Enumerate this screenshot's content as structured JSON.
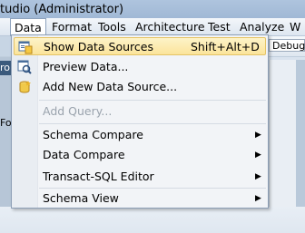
{
  "window": {
    "title": "tudio (Administrator)"
  },
  "menubar": {
    "items": [
      "Data",
      "Format",
      "Tools",
      "Architecture",
      "Test",
      "Analyze",
      "W"
    ]
  },
  "toolbar": {
    "config_value": "Debug"
  },
  "side": {
    "tab1": "ro",
    "tab2": "Fo"
  },
  "menu": {
    "items": [
      {
        "label": "Show Data Sources",
        "shortcut": "Shift+Alt+D",
        "icon": "data-sources-icon"
      },
      {
        "label": "Preview Data...",
        "icon": "preview-data-icon"
      },
      {
        "label": "Add New Data Source...",
        "icon": "add-data-source-icon"
      },
      {
        "label": "Add Query..."
      },
      {
        "label": "Schema Compare"
      },
      {
        "label": "Data Compare"
      },
      {
        "label": "Transact-SQL Editor"
      },
      {
        "label": "Schema View"
      }
    ]
  }
}
